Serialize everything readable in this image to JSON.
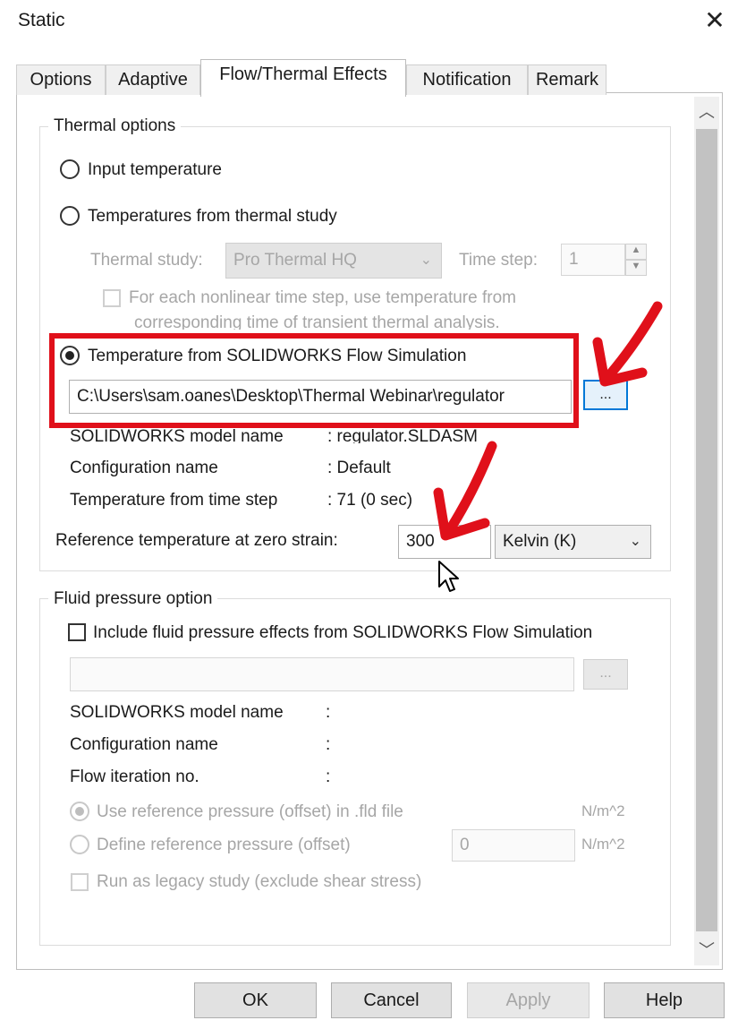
{
  "window": {
    "title": "Static"
  },
  "tabs": [
    {
      "label": "Options"
    },
    {
      "label": "Adaptive"
    },
    {
      "label": "Flow/Thermal Effects"
    },
    {
      "label": "Notification"
    },
    {
      "label": "Remark"
    }
  ],
  "thermal": {
    "group_label": "Thermal options",
    "input_temperature": "Input temperature",
    "from_thermal_study": "Temperatures from thermal study",
    "thermal_study_label": "Thermal study:",
    "thermal_study_value": "Pro Thermal HQ",
    "time_step_label": "Time step:",
    "time_step_value": "1",
    "nonlinear_line1": "For each nonlinear time step, use temperature from",
    "nonlinear_line2": "corresponding time of transient thermal analysis.",
    "flow_sim_option": "Temperature from SOLIDWORKS Flow Simulation",
    "file_path": "C:\\Users\\sam.oanes\\Desktop\\Thermal Webinar\\regulator",
    "browse_label": "...",
    "model_name_label": "SOLIDWORKS model name",
    "model_name_value": ": regulator.SLDASM",
    "config_label": "Configuration name",
    "config_value": ": Default",
    "time_step_from_label": "Temperature from time step",
    "time_step_from_value": ": 71  (0 sec)",
    "ref_temp_label": "Reference temperature at zero strain:",
    "ref_temp_value": "300",
    "unit_value": "Kelvin (K)"
  },
  "fluid": {
    "group_label": "Fluid pressure option",
    "include_label": "Include fluid pressure effects from SOLIDWORKS Flow Simulation",
    "browse_label": "...",
    "model_name_label": "SOLIDWORKS model name",
    "config_label": "Configuration name",
    "iteration_label": "Flow iteration no.",
    "colon": ":",
    "use_ref_label": "Use reference pressure (offset) in .fld file",
    "define_ref_label": "Define reference pressure (offset)",
    "offset_value": "0",
    "unit1": "N/m^2",
    "unit2": "N/m^2",
    "legacy_label": "Run as legacy study (exclude shear stress)"
  },
  "footer": {
    "ok": "OK",
    "cancel": "Cancel",
    "apply": "Apply",
    "help": "Help"
  },
  "colors": {
    "annotation_red": "#e0101a",
    "focus_blue": "#0078d7"
  }
}
